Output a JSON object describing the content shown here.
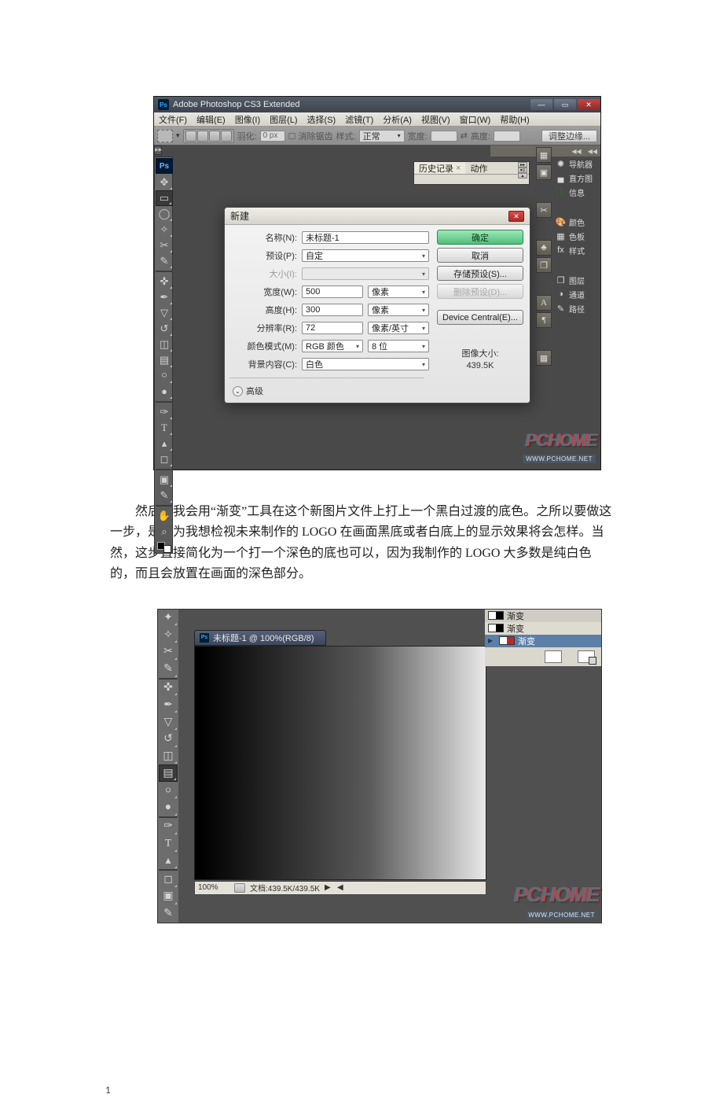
{
  "fig1": {
    "titlebar": {
      "app_icon": "Ps",
      "title": "Adobe Photoshop CS3 Extended"
    },
    "menubar": [
      "文件(F)",
      "编辑(E)",
      "图像(I)",
      "图层(L)",
      "选择(S)",
      "滤镜(T)",
      "分析(A)",
      "视图(V)",
      "窗口(W)",
      "帮助(H)"
    ],
    "optbar": {
      "feather_label": "羽化:",
      "feather_value": "0 px",
      "antialias_label": "消除锯齿",
      "style_label": "样式:",
      "style_value": "正常",
      "width_label": "宽度:",
      "height_label": "高度:",
      "refine_btn": "调整边缘..."
    },
    "history_panel": {
      "tab_history": "历史记录",
      "tab_actions": "动作"
    },
    "dock_labels": [
      "导航器",
      "直方图",
      "信息",
      "颜色",
      "色板",
      "样式",
      "图层",
      "通道",
      "路径"
    ],
    "dialog": {
      "title": "新建",
      "name_label": "名称(N):",
      "name_value": "未标题-1",
      "preset_label": "预设(P):",
      "preset_value": "自定",
      "size_label": "大小(I):",
      "width_label": "宽度(W):",
      "width_value": "500",
      "width_unit": "像素",
      "height_label": "高度(H):",
      "height_value": "300",
      "height_unit": "像素",
      "res_label": "分辨率(R):",
      "res_value": "72",
      "res_unit": "像素/英寸",
      "mode_label": "颜色模式(M):",
      "mode_value": "RGB 颜色",
      "depth_value": "8 位",
      "bg_label": "背景内容(C):",
      "bg_value": "白色",
      "advanced": "高级",
      "btn_ok": "确定",
      "btn_cancel": "取消",
      "btn_savepreset": "存储预设(S)...",
      "btn_delpreset": "删除预设(D)...",
      "btn_device": "Device Central(E)...",
      "imgsize_label": "图像大小:",
      "imgsize_value": "439.5K"
    },
    "watermark_logo": "PCHOME",
    "watermark_url": "WWW.PCHOME.NET"
  },
  "paragraph": {
    "l1": "然后，我会用“渐变”工具在这个新图片文件上打上一个黑白过渡的底色。之所以要做这一步，是因为我想检视未来制作的 LOGO 在画面黑底或者白底上的显示效果将会怎样。当然，这步直接简化为一个打一个深色的底也可以，因为我制作的 LOGO 大多数是纯白色的，而且会放置在画面的深色部分。"
  },
  "fig2": {
    "doc_title": "未标题-1 @ 100%(RGB/8)",
    "status_zoom": "100%",
    "status_doc": "文档:439.5K/439.5K",
    "gradient_tabs": [
      "渐变",
      "渐变",
      "渐变"
    ],
    "watermark_logo": "PCHOME",
    "watermark_url": "WWW.PCHOME.NET"
  },
  "page_number": "1"
}
